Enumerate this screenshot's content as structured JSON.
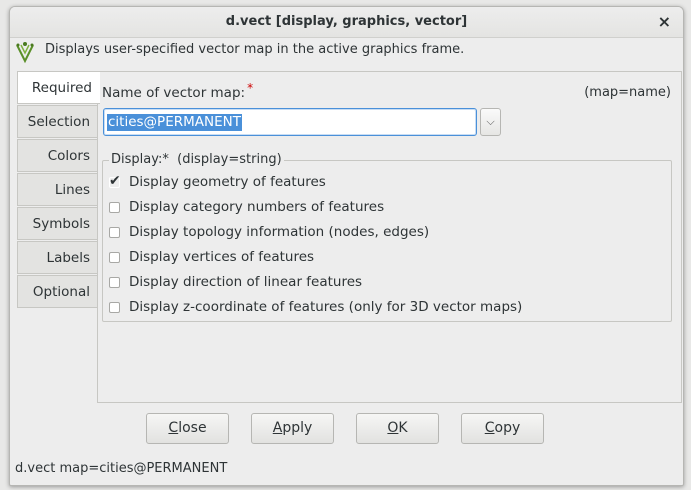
{
  "window": {
    "title": "d.vect [display, graphics, vector]",
    "close_glyph": "×",
    "description": "Displays user-specified vector map in the active graphics frame."
  },
  "tabs": [
    {
      "label": "Required",
      "active": true
    },
    {
      "label": "Selection",
      "active": false
    },
    {
      "label": "Colors",
      "active": false
    },
    {
      "label": "Lines",
      "active": false
    },
    {
      "label": "Symbols",
      "active": false
    },
    {
      "label": "Labels",
      "active": false
    },
    {
      "label": "Optional",
      "active": false
    }
  ],
  "map_field": {
    "label": "Name of vector map:",
    "required_mark": "*",
    "key": "(map=name)",
    "value": "cities@PERMANENT"
  },
  "display_group": {
    "legend": "Display:*",
    "key": "(display=string)",
    "options": [
      {
        "label": "Display geometry of features",
        "checked": true
      },
      {
        "label": "Display category numbers of features",
        "checked": false
      },
      {
        "label": "Display topology information (nodes, edges)",
        "checked": false
      },
      {
        "label": "Display vertices of features",
        "checked": false
      },
      {
        "label": "Display direction of linear features",
        "checked": false
      },
      {
        "label": "Display z-coordinate of features (only for 3D vector maps)",
        "checked": false
      }
    ]
  },
  "buttons": {
    "close": {
      "mnemonic": "C",
      "rest": "lose"
    },
    "apply": {
      "mnemonic": "A",
      "rest": "pply"
    },
    "ok": {
      "mnemonic": "O",
      "rest": "K"
    },
    "copy": {
      "mnemonic": "C",
      "rest": "opy"
    }
  },
  "status": "d.vect map=cities@PERMANENT",
  "icons": {
    "module": "vector-display-icon",
    "dropdown": "chevron-down-icon",
    "check": "checkmark-icon"
  }
}
